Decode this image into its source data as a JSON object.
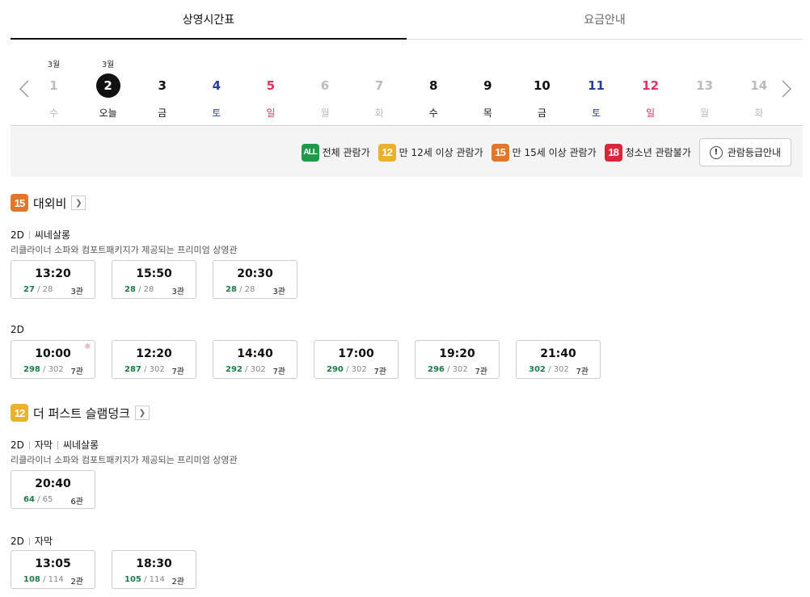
{
  "tabs": [
    {
      "label": "상영시간표",
      "active": true
    },
    {
      "label": "요금안내",
      "active": false
    }
  ],
  "dates": [
    {
      "month": "3월",
      "day": "1",
      "weekday": "수",
      "color": "gray"
    },
    {
      "month": "3월",
      "day": "2",
      "weekday": "오늘",
      "color": "today"
    },
    {
      "month": "",
      "day": "3",
      "weekday": "금",
      "color": "black"
    },
    {
      "month": "",
      "day": "4",
      "weekday": "토",
      "color": "blue"
    },
    {
      "month": "",
      "day": "5",
      "weekday": "일",
      "color": "red"
    },
    {
      "month": "",
      "day": "6",
      "weekday": "월",
      "color": "gray"
    },
    {
      "month": "",
      "day": "7",
      "weekday": "화",
      "color": "gray"
    },
    {
      "month": "",
      "day": "8",
      "weekday": "수",
      "color": "black"
    },
    {
      "month": "",
      "day": "9",
      "weekday": "목",
      "color": "black"
    },
    {
      "month": "",
      "day": "10",
      "weekday": "금",
      "color": "black"
    },
    {
      "month": "",
      "day": "11",
      "weekday": "토",
      "color": "blue"
    },
    {
      "month": "",
      "day": "12",
      "weekday": "일",
      "color": "red"
    },
    {
      "month": "",
      "day": "13",
      "weekday": "월",
      "color": "gray"
    },
    {
      "month": "",
      "day": "14",
      "weekday": "화",
      "color": "gray"
    }
  ],
  "legend": {
    "all_badge": "ALL",
    "all_label": "전체 관람가",
    "b12_badge": "12",
    "b12_label": "만 12세 이상 관람가",
    "b15_badge": "15",
    "b15_label": "만 15세 이상 관람가",
    "b18_badge": "18",
    "b18_label": "청소년 관람불가",
    "info_button": "관람등급안내"
  },
  "colors": {
    "all": "#1f9a4b",
    "age12": "#e8b22a",
    "age15": "#e0772c",
    "age18": "#d9263b",
    "remaining_seats": "#1f7a49"
  },
  "movies": [
    {
      "rating": "15",
      "title": "대외비",
      "groups": [
        {
          "format": "2D",
          "hall_type": "씨네살롱",
          "description": "리클라이너 소파와 컴포트패키지가 제공되는 프리미엄 상영관",
          "showtimes": [
            {
              "time": "13:20",
              "remaining": "27",
              "total": "/ 28",
              "hall": "3관"
            },
            {
              "time": "15:50",
              "remaining": "28",
              "total": "/ 28",
              "hall": "3관"
            },
            {
              "time": "20:30",
              "remaining": "28",
              "total": "/ 28",
              "hall": "3관"
            }
          ]
        },
        {
          "format": "2D",
          "showtimes": [
            {
              "time": "10:00",
              "remaining": "298",
              "total": "/ 302",
              "hall": "7관",
              "morning": true
            },
            {
              "time": "12:20",
              "remaining": "287",
              "total": "/ 302",
              "hall": "7관"
            },
            {
              "time": "14:40",
              "remaining": "292",
              "total": "/ 302",
              "hall": "7관"
            },
            {
              "time": "17:00",
              "remaining": "290",
              "total": "/ 302",
              "hall": "7관"
            },
            {
              "time": "19:20",
              "remaining": "296",
              "total": "/ 302",
              "hall": "7관"
            },
            {
              "time": "21:40",
              "remaining": "302",
              "total": "/ 302",
              "hall": "7관"
            }
          ]
        }
      ]
    },
    {
      "rating": "12",
      "title": "더 퍼스트 슬램덩크",
      "groups": [
        {
          "format": "2D",
          "subtitle": "자막",
          "hall_type": "씨네살롱",
          "description": "리클라이너 소파와 컴포트패키지가 제공되는 프리미엄 상영관",
          "showtimes": [
            {
              "time": "20:40",
              "remaining": "64",
              "total": "/ 65",
              "hall": "6관"
            }
          ]
        },
        {
          "format": "2D",
          "subtitle": "자막",
          "showtimes": [
            {
              "time": "13:05",
              "remaining": "108",
              "total": "/ 114",
              "hall": "2관"
            },
            {
              "time": "18:30",
              "remaining": "105",
              "total": "/ 114",
              "hall": "2관"
            }
          ]
        }
      ]
    }
  ]
}
